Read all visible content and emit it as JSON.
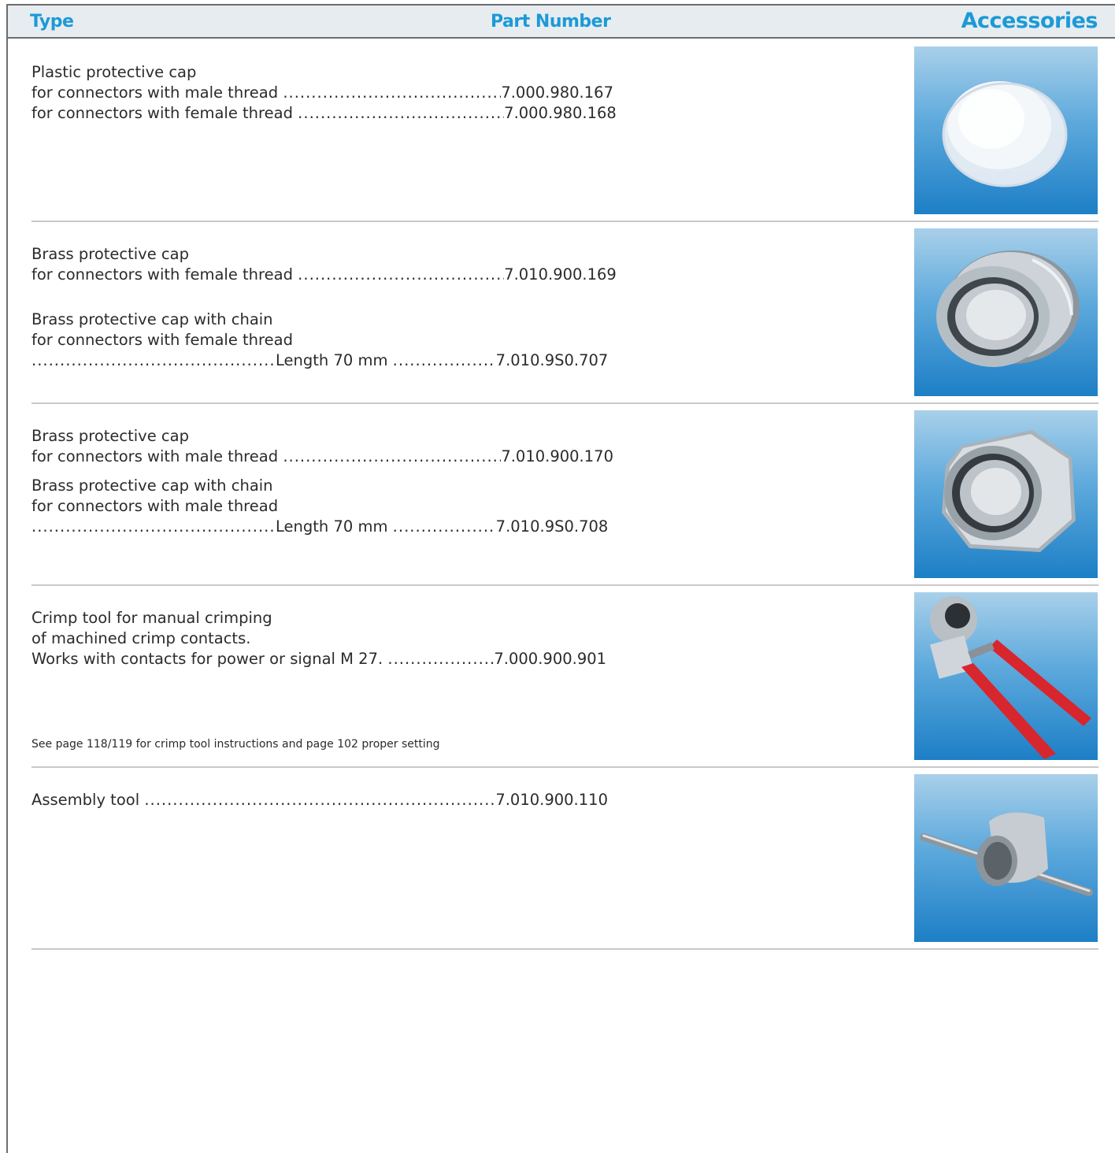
{
  "header": {
    "type_label": "Type",
    "part_number_label": "Part Number",
    "accessories_label": "Accessories"
  },
  "sections": [
    {
      "title": "Plastic protective cap",
      "lines": [
        {
          "text": "for connectors with male thread",
          "part": "7.000.980.167"
        },
        {
          "text": "for connectors with female thread",
          "part": "7.000.980.168"
        }
      ],
      "photo_icon": "plastic-cap-icon"
    },
    {
      "title": "Brass protective cap",
      "lines": [
        {
          "text": "for connectors with female thread",
          "part": "7.010.900.169"
        }
      ],
      "sub_title": "Brass protective cap with chain",
      "sub_text": "for connectors with female thread",
      "length_label": "Length 70 mm",
      "length_part": "7.010.9S0.707",
      "photo_icon": "brass-cap-female-icon"
    },
    {
      "title": "Brass protective cap",
      "lines": [
        {
          "text": "for connectors with male thread",
          "part": "7.010.900.170"
        }
      ],
      "sub_title": "Brass protective cap with chain",
      "sub_text": "for connectors with male thread",
      "length_label": "Length 70 mm",
      "length_part": "7.010.9S0.708",
      "photo_icon": "brass-cap-male-icon"
    },
    {
      "title": "Crimp tool for manual crimping",
      "line2": "of machined crimp contacts.",
      "line3": "Works with contacts for power or signal M 27.",
      "part": "7.000.900.901",
      "note": "See page 118/119 for crimp tool instructions and page 102 proper setting",
      "photo_icon": "crimp-tool-icon"
    },
    {
      "title": "Assembly tool",
      "part": "7.010.900.110",
      "photo_icon": "assembly-tool-icon"
    }
  ],
  "colors": {
    "accent": "#1c9ad6",
    "photo_background": "#1d7fc6"
  }
}
